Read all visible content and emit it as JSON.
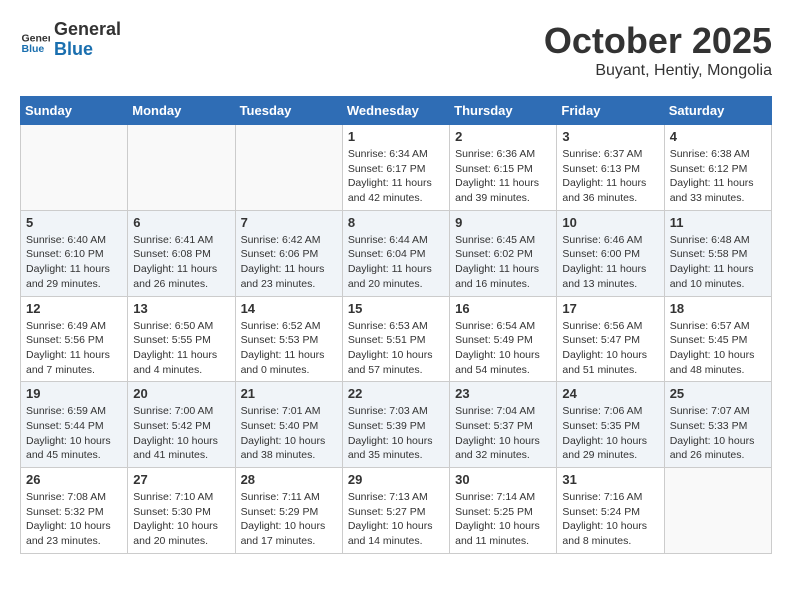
{
  "header": {
    "logo_general": "General",
    "logo_blue": "Blue",
    "month_title": "October 2025",
    "subtitle": "Buyant, Hentiy, Mongolia"
  },
  "days_of_week": [
    "Sunday",
    "Monday",
    "Tuesday",
    "Wednesday",
    "Thursday",
    "Friday",
    "Saturday"
  ],
  "weeks": [
    {
      "shaded": false,
      "days": [
        {
          "num": "",
          "info": ""
        },
        {
          "num": "",
          "info": ""
        },
        {
          "num": "",
          "info": ""
        },
        {
          "num": "1",
          "info": "Sunrise: 6:34 AM\nSunset: 6:17 PM\nDaylight: 11 hours\nand 42 minutes."
        },
        {
          "num": "2",
          "info": "Sunrise: 6:36 AM\nSunset: 6:15 PM\nDaylight: 11 hours\nand 39 minutes."
        },
        {
          "num": "3",
          "info": "Sunrise: 6:37 AM\nSunset: 6:13 PM\nDaylight: 11 hours\nand 36 minutes."
        },
        {
          "num": "4",
          "info": "Sunrise: 6:38 AM\nSunset: 6:12 PM\nDaylight: 11 hours\nand 33 minutes."
        }
      ]
    },
    {
      "shaded": true,
      "days": [
        {
          "num": "5",
          "info": "Sunrise: 6:40 AM\nSunset: 6:10 PM\nDaylight: 11 hours\nand 29 minutes."
        },
        {
          "num": "6",
          "info": "Sunrise: 6:41 AM\nSunset: 6:08 PM\nDaylight: 11 hours\nand 26 minutes."
        },
        {
          "num": "7",
          "info": "Sunrise: 6:42 AM\nSunset: 6:06 PM\nDaylight: 11 hours\nand 23 minutes."
        },
        {
          "num": "8",
          "info": "Sunrise: 6:44 AM\nSunset: 6:04 PM\nDaylight: 11 hours\nand 20 minutes."
        },
        {
          "num": "9",
          "info": "Sunrise: 6:45 AM\nSunset: 6:02 PM\nDaylight: 11 hours\nand 16 minutes."
        },
        {
          "num": "10",
          "info": "Sunrise: 6:46 AM\nSunset: 6:00 PM\nDaylight: 11 hours\nand 13 minutes."
        },
        {
          "num": "11",
          "info": "Sunrise: 6:48 AM\nSunset: 5:58 PM\nDaylight: 11 hours\nand 10 minutes."
        }
      ]
    },
    {
      "shaded": false,
      "days": [
        {
          "num": "12",
          "info": "Sunrise: 6:49 AM\nSunset: 5:56 PM\nDaylight: 11 hours\nand 7 minutes."
        },
        {
          "num": "13",
          "info": "Sunrise: 6:50 AM\nSunset: 5:55 PM\nDaylight: 11 hours\nand 4 minutes."
        },
        {
          "num": "14",
          "info": "Sunrise: 6:52 AM\nSunset: 5:53 PM\nDaylight: 11 hours\nand 0 minutes."
        },
        {
          "num": "15",
          "info": "Sunrise: 6:53 AM\nSunset: 5:51 PM\nDaylight: 10 hours\nand 57 minutes."
        },
        {
          "num": "16",
          "info": "Sunrise: 6:54 AM\nSunset: 5:49 PM\nDaylight: 10 hours\nand 54 minutes."
        },
        {
          "num": "17",
          "info": "Sunrise: 6:56 AM\nSunset: 5:47 PM\nDaylight: 10 hours\nand 51 minutes."
        },
        {
          "num": "18",
          "info": "Sunrise: 6:57 AM\nSunset: 5:45 PM\nDaylight: 10 hours\nand 48 minutes."
        }
      ]
    },
    {
      "shaded": true,
      "days": [
        {
          "num": "19",
          "info": "Sunrise: 6:59 AM\nSunset: 5:44 PM\nDaylight: 10 hours\nand 45 minutes."
        },
        {
          "num": "20",
          "info": "Sunrise: 7:00 AM\nSunset: 5:42 PM\nDaylight: 10 hours\nand 41 minutes."
        },
        {
          "num": "21",
          "info": "Sunrise: 7:01 AM\nSunset: 5:40 PM\nDaylight: 10 hours\nand 38 minutes."
        },
        {
          "num": "22",
          "info": "Sunrise: 7:03 AM\nSunset: 5:39 PM\nDaylight: 10 hours\nand 35 minutes."
        },
        {
          "num": "23",
          "info": "Sunrise: 7:04 AM\nSunset: 5:37 PM\nDaylight: 10 hours\nand 32 minutes."
        },
        {
          "num": "24",
          "info": "Sunrise: 7:06 AM\nSunset: 5:35 PM\nDaylight: 10 hours\nand 29 minutes."
        },
        {
          "num": "25",
          "info": "Sunrise: 7:07 AM\nSunset: 5:33 PM\nDaylight: 10 hours\nand 26 minutes."
        }
      ]
    },
    {
      "shaded": false,
      "days": [
        {
          "num": "26",
          "info": "Sunrise: 7:08 AM\nSunset: 5:32 PM\nDaylight: 10 hours\nand 23 minutes."
        },
        {
          "num": "27",
          "info": "Sunrise: 7:10 AM\nSunset: 5:30 PM\nDaylight: 10 hours\nand 20 minutes."
        },
        {
          "num": "28",
          "info": "Sunrise: 7:11 AM\nSunset: 5:29 PM\nDaylight: 10 hours\nand 17 minutes."
        },
        {
          "num": "29",
          "info": "Sunrise: 7:13 AM\nSunset: 5:27 PM\nDaylight: 10 hours\nand 14 minutes."
        },
        {
          "num": "30",
          "info": "Sunrise: 7:14 AM\nSunset: 5:25 PM\nDaylight: 10 hours\nand 11 minutes."
        },
        {
          "num": "31",
          "info": "Sunrise: 7:16 AM\nSunset: 5:24 PM\nDaylight: 10 hours\nand 8 minutes."
        },
        {
          "num": "",
          "info": ""
        }
      ]
    }
  ]
}
